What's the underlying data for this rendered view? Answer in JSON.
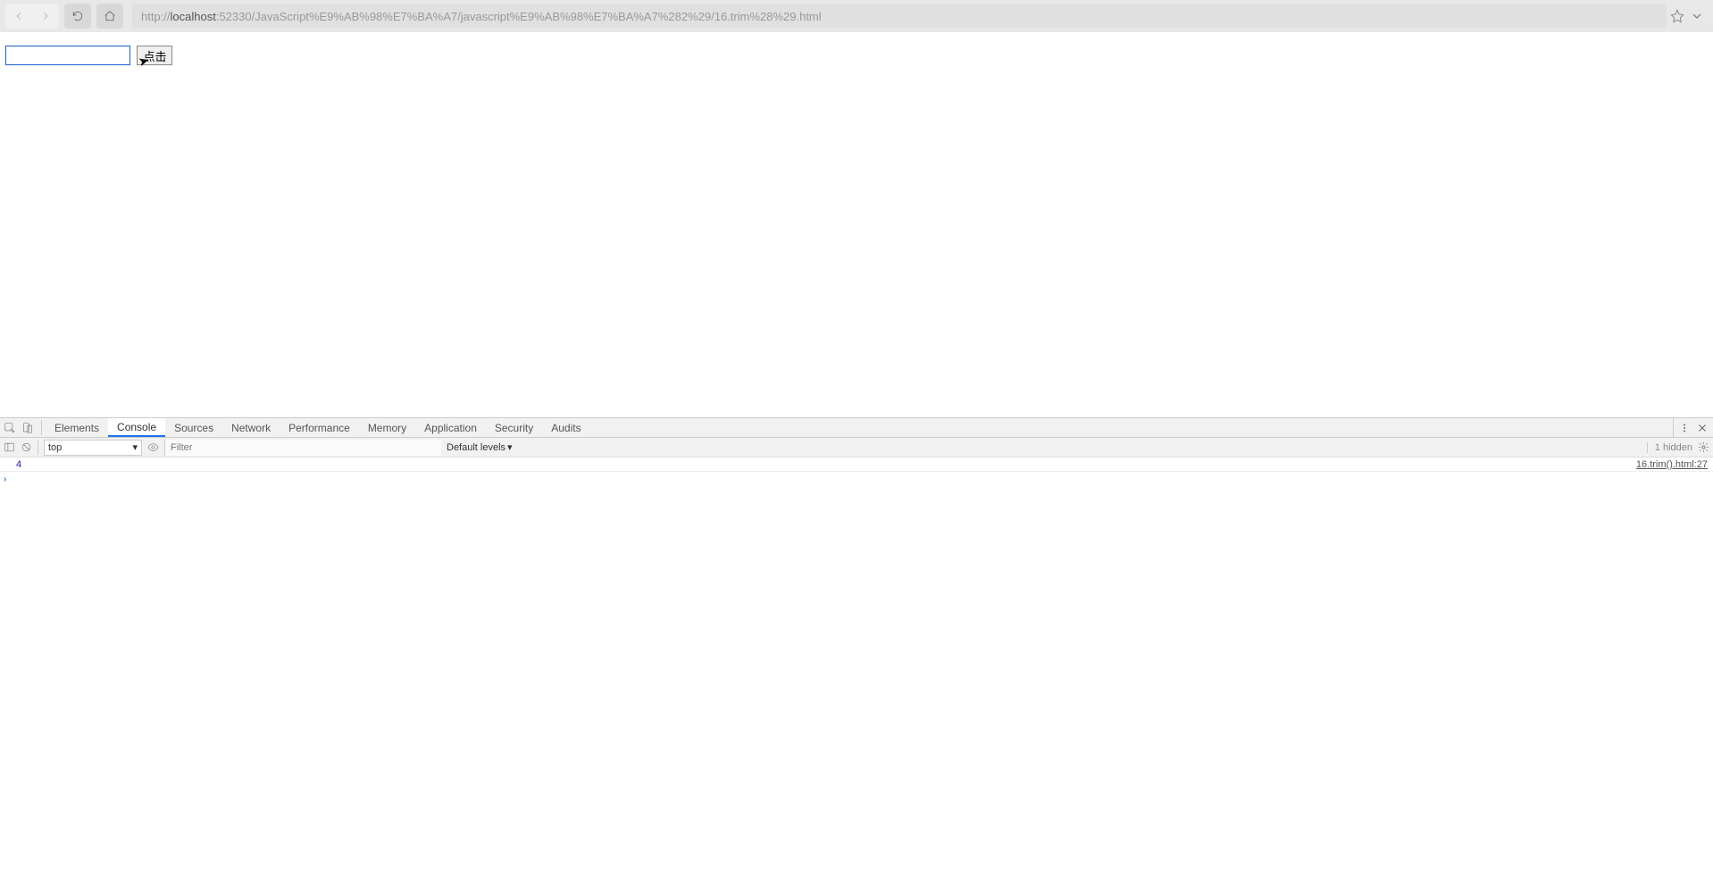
{
  "browser": {
    "url_prefix": "http://",
    "url_host": "localhost",
    "url_rest": ":52330/JavaScript%E9%AB%98%E7%BA%A7/javascript%E9%AB%98%E7%BA%A7%282%29/16.trim%28%29.html"
  },
  "page": {
    "button_label": "点击",
    "input_value": ""
  },
  "devtools": {
    "tabs": {
      "elements": "Elements",
      "console": "Console",
      "sources": "Sources",
      "network": "Network",
      "performance": "Performance",
      "memory": "Memory",
      "application": "Application",
      "security": "Security",
      "audits": "Audits"
    },
    "console_toolbar": {
      "context": "top",
      "filter_placeholder": "Filter",
      "levels": "Default levels",
      "hidden": "1 hidden"
    },
    "console": {
      "value": "4",
      "source": "16.trim().html:27",
      "prompt": "›"
    }
  }
}
